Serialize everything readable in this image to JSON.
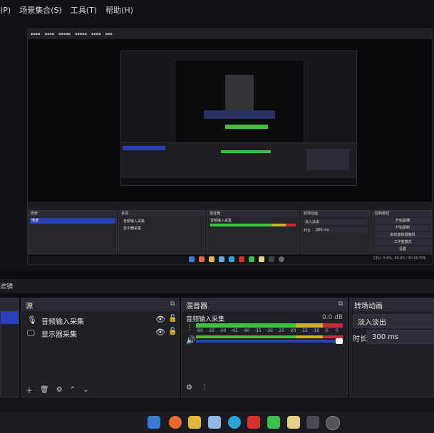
{
  "menu": {
    "item_view_frag": "(P)",
    "item_scene_collection": "场景集合(S)",
    "item_tools": "工具(T)",
    "item_help": "帮助(H)"
  },
  "inner": {
    "docks": {
      "scenes_title": "场景",
      "scene_item": "场景",
      "sources_title": "来源",
      "source_1": "音频输入采集",
      "source_2": "显示器采集",
      "mixer_title": "混音器",
      "mixer_channel": "音频输入采集",
      "transitions_title": "转场动画",
      "transition_value": "淡入淡出",
      "duration_label": "时长",
      "duration_value": "300 ms",
      "controls_title": "控制按钮",
      "btn_stream": "开始直播",
      "btn_record": "开始录制",
      "btn_vcam": "启动虚拟摄像机",
      "btn_studio": "工作室模式",
      "btn_settings": "设置"
    },
    "status_fps": "CPU: 0.8%, 30.00 / 30.00 FPS"
  },
  "main": {
    "tab_fragment": "滤镜",
    "sources": {
      "title": "源",
      "items": [
        {
          "label": "音频输入采集",
          "icon": "microphone-icon"
        },
        {
          "label": "显示器采集",
          "icon": "monitor-icon"
        }
      ]
    },
    "mixer": {
      "title": "混音器",
      "channel_name": "音频输入采集",
      "channel_db": "0.0 dB",
      "ticks": [
        "-60",
        "-55",
        "-50",
        "-45",
        "-40",
        "-35",
        "-30",
        "-25",
        "-20",
        "-15",
        "-10",
        "-5",
        "0"
      ]
    },
    "transitions": {
      "title": "转场动画",
      "current": "淡入淡出",
      "duration_label": "时长",
      "duration_value": "300 ms"
    }
  },
  "colors": {
    "accent_blue": "#2a3fb8",
    "meter_green": "#3cc43c",
    "meter_yellow": "#c8b12c",
    "meter_red": "#c82c3c"
  }
}
